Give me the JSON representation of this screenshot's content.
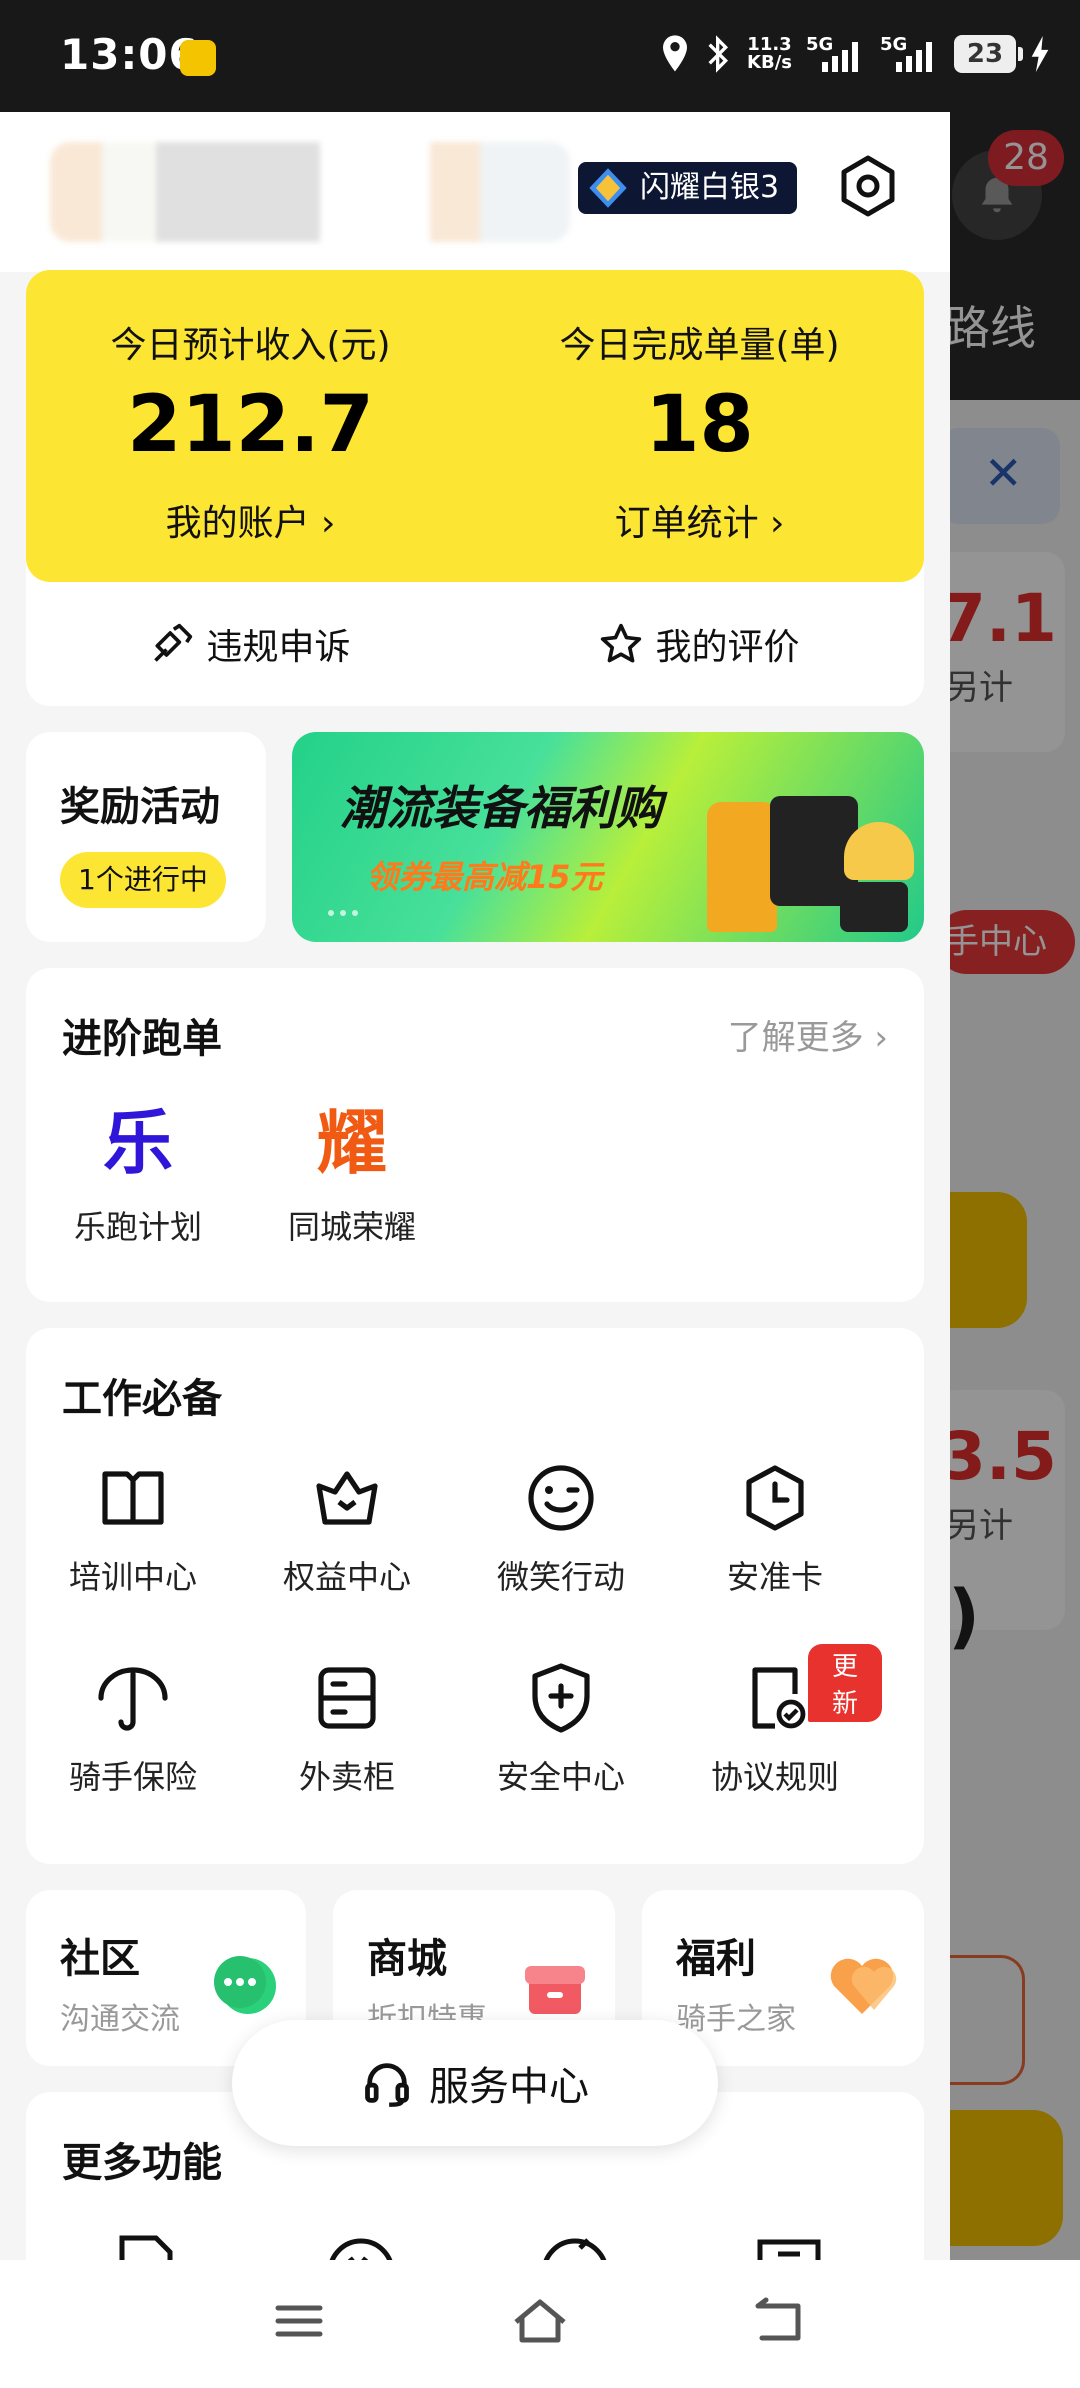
{
  "status_bar": {
    "time": "13:06",
    "net_speed": "11.3",
    "net_speed_unit": "KB/s",
    "network1": "5G",
    "network2": "5G",
    "battery": "23"
  },
  "background": {
    "route_text": "路线",
    "notification_count": "28",
    "value1": "7.1",
    "sub1": "另计",
    "red_label": "手中心",
    "value2": "3.5",
    "sub2": "另计",
    "paren": ")"
  },
  "profile": {
    "rank_label": "闪耀白银3"
  },
  "income": {
    "income_label": "今日预计收入(元)",
    "income_value": "212.7",
    "account_link": "我的账户",
    "orders_label": "今日完成单量(单)",
    "orders_value": "18",
    "orders_link": "订单统计",
    "appeal": "违规申诉",
    "rating": "我的评价"
  },
  "reward": {
    "title": "奖励活动",
    "badge": "1个进行中"
  },
  "banner": {
    "title": "潮流装备福利购",
    "subtitle": "领券最高减15元",
    "accent_color": "#ff7a1a"
  },
  "advanced": {
    "title": "进阶跑单",
    "more": "了解更多",
    "items": [
      {
        "glyph": "乐",
        "label": "乐跑计划",
        "color": "#2f16d8"
      },
      {
        "glyph": "耀",
        "label": "同城荣耀",
        "color": "#f05a12"
      }
    ]
  },
  "work": {
    "title": "工作必备",
    "items": [
      {
        "label": "培训中心",
        "icon": "book-icon"
      },
      {
        "label": "权益中心",
        "icon": "crown-icon"
      },
      {
        "label": "微笑行动",
        "icon": "smile-icon"
      },
      {
        "label": "安准卡",
        "icon": "clock-icon"
      },
      {
        "label": "骑手保险",
        "icon": "umbrella-icon"
      },
      {
        "label": "外卖柜",
        "icon": "locker-icon"
      },
      {
        "label": "安全中心",
        "icon": "shield-icon"
      },
      {
        "label": "协议规则",
        "icon": "agreement-icon"
      }
    ],
    "new_badge": "更新"
  },
  "mini_cards": [
    {
      "title": "社区",
      "sub": "沟通交流"
    },
    {
      "title": "商城",
      "sub": "折扣特惠"
    },
    {
      "title": "福利",
      "sub": "骑手之家"
    }
  ],
  "more_functions": {
    "title": "更多功能"
  },
  "service_center": "服务中心"
}
